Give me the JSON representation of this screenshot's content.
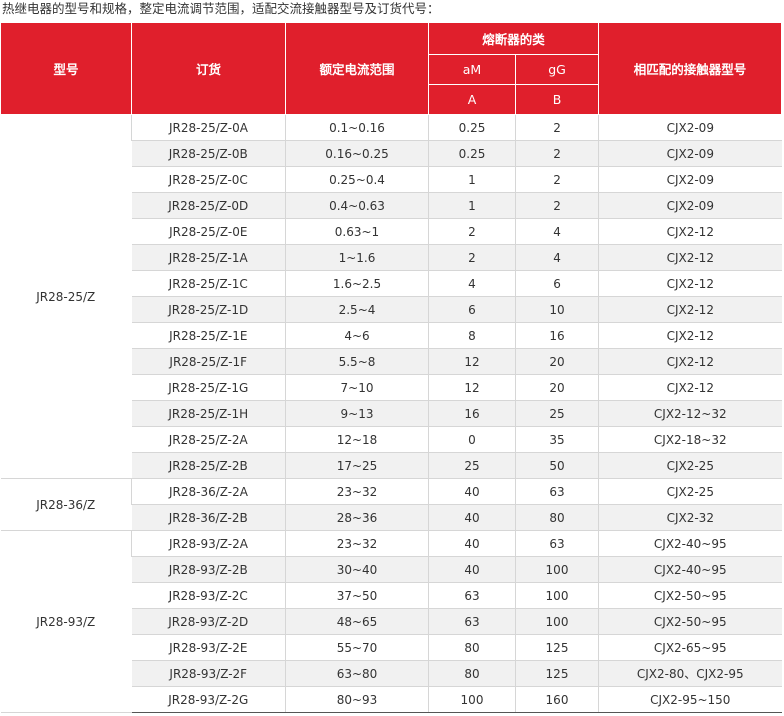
{
  "caption": "热继电器的型号和规格，整定电流调节范围，适配交流接触器型号及订货代号：",
  "header": {
    "model": "型号",
    "order": "订货",
    "current_range": "额定电流范围",
    "fuse_group": "熔断器的类",
    "fuse_am": "aM",
    "fuse_gg": "gG",
    "fuse_a": "A",
    "fuse_b": "B",
    "contactor": "相匹配的接触器型号"
  },
  "groups": [
    {
      "model": "JR28-25/Z",
      "rows": [
        {
          "order": "JR28-25/Z-0A",
          "range": "0.1~0.16",
          "am": "0.25",
          "gg": "2",
          "contactor": "CJX2-09"
        },
        {
          "order": "JR28-25/Z-0B",
          "range": "0.16~0.25",
          "am": "0.25",
          "gg": "2",
          "contactor": "CJX2-09"
        },
        {
          "order": "JR28-25/Z-0C",
          "range": "0.25~0.4",
          "am": "1",
          "gg": "2",
          "contactor": "CJX2-09"
        },
        {
          "order": "JR28-25/Z-0D",
          "range": "0.4~0.63",
          "am": "1",
          "gg": "2",
          "contactor": "CJX2-09"
        },
        {
          "order": "JR28-25/Z-0E",
          "range": "0.63~1",
          "am": "2",
          "gg": "4",
          "contactor": "CJX2-12"
        },
        {
          "order": "JR28-25/Z-1A",
          "range": "1~1.6",
          "am": "2",
          "gg": "4",
          "contactor": "CJX2-12"
        },
        {
          "order": "JR28-25/Z-1C",
          "range": "1.6~2.5",
          "am": "4",
          "gg": "6",
          "contactor": "CJX2-12"
        },
        {
          "order": "JR28-25/Z-1D",
          "range": "2.5~4",
          "am": "6",
          "gg": "10",
          "contactor": "CJX2-12"
        },
        {
          "order": "JR28-25/Z-1E",
          "range": "4~6",
          "am": "8",
          "gg": "16",
          "contactor": "CJX2-12"
        },
        {
          "order": "JR28-25/Z-1F",
          "range": "5.5~8",
          "am": "12",
          "gg": "20",
          "contactor": "CJX2-12"
        },
        {
          "order": "JR28-25/Z-1G",
          "range": "7~10",
          "am": "12",
          "gg": "20",
          "contactor": "CJX2-12"
        },
        {
          "order": "JR28-25/Z-1H",
          "range": "9~13",
          "am": "16",
          "gg": "25",
          "contactor": "CJX2-12~32"
        },
        {
          "order": "JR28-25/Z-2A",
          "range": "12~18",
          "am": "0",
          "gg": "35",
          "contactor": "CJX2-18~32"
        },
        {
          "order": "JR28-25/Z-2B",
          "range": "17~25",
          "am": "25",
          "gg": "50",
          "contactor": "CJX2-25"
        }
      ]
    },
    {
      "model": "JR28-36/Z",
      "rows": [
        {
          "order": "JR28-36/Z-2A",
          "range": "23~32",
          "am": "40",
          "gg": "63",
          "contactor": "CJX2-25"
        },
        {
          "order": "JR28-36/Z-2B",
          "range": "28~36",
          "am": "40",
          "gg": "80",
          "contactor": "CJX2-32"
        }
      ]
    },
    {
      "model": "JR28-93/Z",
      "rows": [
        {
          "order": "JR28-93/Z-2A",
          "range": "23~32",
          "am": "40",
          "gg": "63",
          "contactor": "CJX2-40~95"
        },
        {
          "order": "JR28-93/Z-2B",
          "range": "30~40",
          "am": "40",
          "gg": "100",
          "contactor": "CJX2-40~95"
        },
        {
          "order": "JR28-93/Z-2C",
          "range": "37~50",
          "am": "63",
          "gg": "100",
          "contactor": "CJX2-50~95"
        },
        {
          "order": "JR28-93/Z-2D",
          "range": "48~65",
          "am": "63",
          "gg": "100",
          "contactor": "CJX2-50~95"
        },
        {
          "order": "JR28-93/Z-2E",
          "range": "55~70",
          "am": "80",
          "gg": "125",
          "contactor": "CJX2-65~95"
        },
        {
          "order": "JR28-93/Z-2F",
          "range": "63~80",
          "am": "80",
          "gg": "125",
          "contactor": "CJX2-80、CJX2-95"
        },
        {
          "order": "JR28-93/Z-2G",
          "range": "80~93",
          "am": "100",
          "gg": "160",
          "contactor": "CJX2-95~150"
        }
      ]
    }
  ],
  "colors": {
    "header_bg": "#e01f2c",
    "header_text": "#ffffff",
    "row_stripe": "#f1f1f1"
  }
}
